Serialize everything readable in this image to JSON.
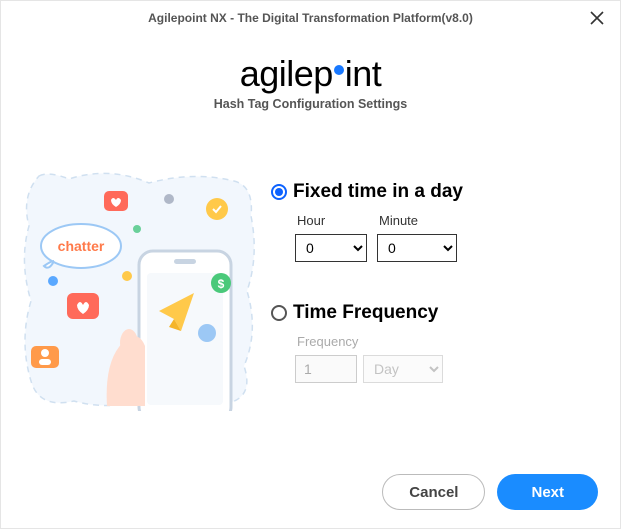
{
  "window": {
    "title": "Agilepoint NX - The Digital Transformation Platform(v8.0)"
  },
  "header": {
    "logo_prefix": "agilep",
    "logo_suffix": "int",
    "subtitle": "Hash Tag Configuration Settings"
  },
  "illustration": {
    "bubble_text": "chatter"
  },
  "form": {
    "fixed_time": {
      "label": "Fixed time in a day",
      "selected": true,
      "hour_label": "Hour",
      "hour_value": "0",
      "minute_label": "Minute",
      "minute_value": "0"
    },
    "time_frequency": {
      "label": "Time Frequency",
      "selected": false,
      "frequency_label": "Frequency",
      "frequency_value": "1",
      "unit_value": "Day"
    }
  },
  "footer": {
    "cancel": "Cancel",
    "next": "Next"
  }
}
